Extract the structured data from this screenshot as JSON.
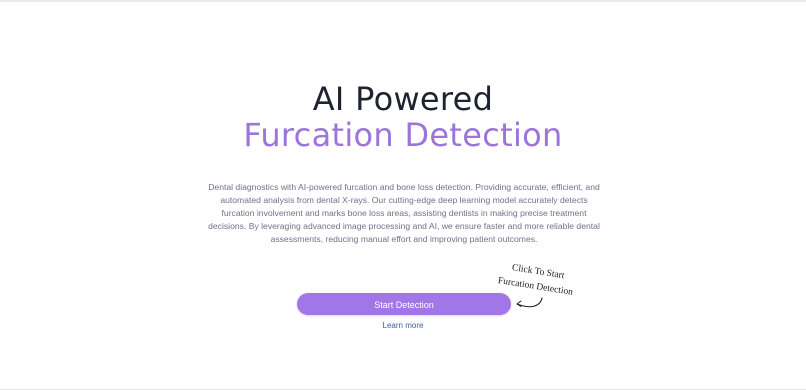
{
  "hero": {
    "title_line_1": "AI Powered",
    "title_line_2": "Furcation Detection",
    "description": "Dental diagnostics with AI-powered furcation and bone loss detection. Providing accurate, efficient, and automated analysis from dental X-rays. Our cutting-edge deep learning model accurately detects furcation involvement and marks bone loss areas, assisting dentists in making precise treatment decisions. By leveraging advanced image processing and AI, we ensure faster and more reliable dental assessments, reducing manual effort and improving patient outcomes."
  },
  "actions": {
    "start_label": "Start Detection",
    "learn_more_label": "Learn more"
  },
  "annotation": {
    "line_1": "Click To Start",
    "line_2": "Furcation Detection",
    "icon": "curved-arrow-icon"
  },
  "colors": {
    "title_dark": "#1f2330",
    "title_accent": "#9b75dc",
    "button_bg": "#a176e6",
    "link": "#3a5fa0",
    "body_text": "#6d7289"
  }
}
